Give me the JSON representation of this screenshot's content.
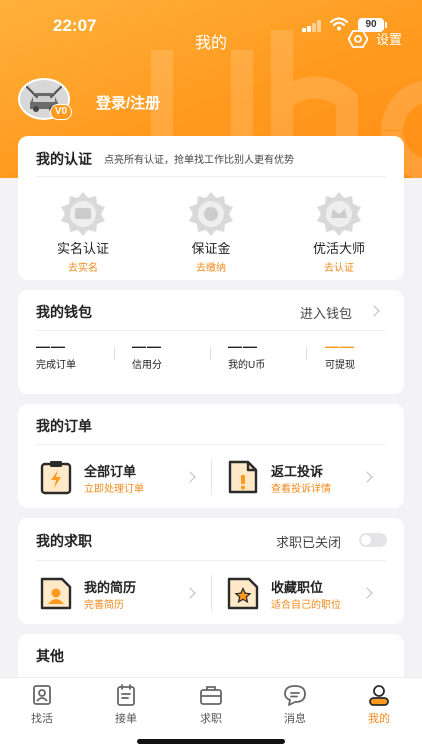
{
  "status_bar": {
    "time": "22:07",
    "battery": "90"
  },
  "header": {
    "title": "我的",
    "settings_label": "设置"
  },
  "profile": {
    "level": "V0",
    "login_label": "登录/注册"
  },
  "certification": {
    "title": "我的认证",
    "subtitle": "点亮所有认证，抢单找工作比别人更有优势",
    "items": [
      {
        "name": "实名认证",
        "action": "去实名",
        "icon": "id-card-badge-icon"
      },
      {
        "name": "保证金",
        "action": "去缴纳",
        "icon": "deposit-badge-icon"
      },
      {
        "name": "优活大师",
        "action": "去认证",
        "icon": "master-badge-icon"
      }
    ]
  },
  "wallet": {
    "title": "我的钱包",
    "link_label": "进入钱包",
    "stats": [
      {
        "value": "——",
        "label": "完成订单"
      },
      {
        "value": "——",
        "label": "信用分"
      },
      {
        "value": "——",
        "label": "我的U币"
      },
      {
        "value": "——",
        "label": "可提现"
      }
    ]
  },
  "orders": {
    "title": "我的订单",
    "entries": [
      {
        "title": "全部订单",
        "subtitle": "立即处理订单"
      },
      {
        "title": "返工投诉",
        "subtitle": "查看投诉详情"
      }
    ]
  },
  "jobs": {
    "title": "我的求职",
    "toggle_label": "求职已关闭",
    "entries": [
      {
        "title": "我的简历",
        "subtitle": "完善简历"
      },
      {
        "title": "收藏职位",
        "subtitle": "适合自己的职位"
      }
    ]
  },
  "other": {
    "title": "其他"
  },
  "tabbar": {
    "tabs": [
      {
        "label": "找活"
      },
      {
        "label": "接单"
      },
      {
        "label": "求职"
      },
      {
        "label": "消息"
      },
      {
        "label": "我的"
      }
    ]
  },
  "colors": {
    "accent": "#ff9a1f",
    "accent_text": "#f08a1a"
  }
}
